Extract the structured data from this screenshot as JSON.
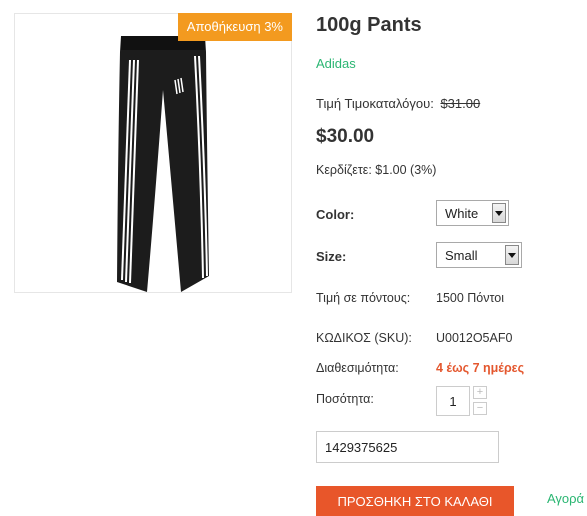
{
  "product": {
    "badge": "Αποθήκευση 3%",
    "title": "100g Pants",
    "brand": "Adidas",
    "list_price_label": "Τιμή Τιμοκαταλόγου:",
    "list_price": "$31.00",
    "price": "$30.00",
    "savings": "Κερδίζετε: $1.00 (3%)"
  },
  "options": {
    "color_label": "Color:",
    "color_value": "White",
    "size_label": "Size:",
    "size_value": "Small"
  },
  "details": {
    "points_label": "Τιμή σε πόντους:",
    "points_value": "1500 Πόντοι",
    "sku_label": "ΚΩΔΙΚΟΣ (SKU):",
    "sku_value": "U0012O5AF0",
    "availability_label": "Διαθεσιμότητα:",
    "availability_value": "4 έως 7 ημέρες",
    "quantity_label": "Ποσότητα:",
    "quantity_value": "1"
  },
  "actions": {
    "plus": "+",
    "minus": "−",
    "gift_input_value": "1429375625",
    "add_to_cart": "ΠΡΟΣΘΗΚΗ ΣΤΟ ΚΑΛΑΘΙ",
    "buy_link": "Αγορά"
  },
  "colors": {
    "badge": "#f39a1f",
    "brand": "#2bb673",
    "availability": "#e4572e",
    "add_to_cart": "#e8562a"
  }
}
